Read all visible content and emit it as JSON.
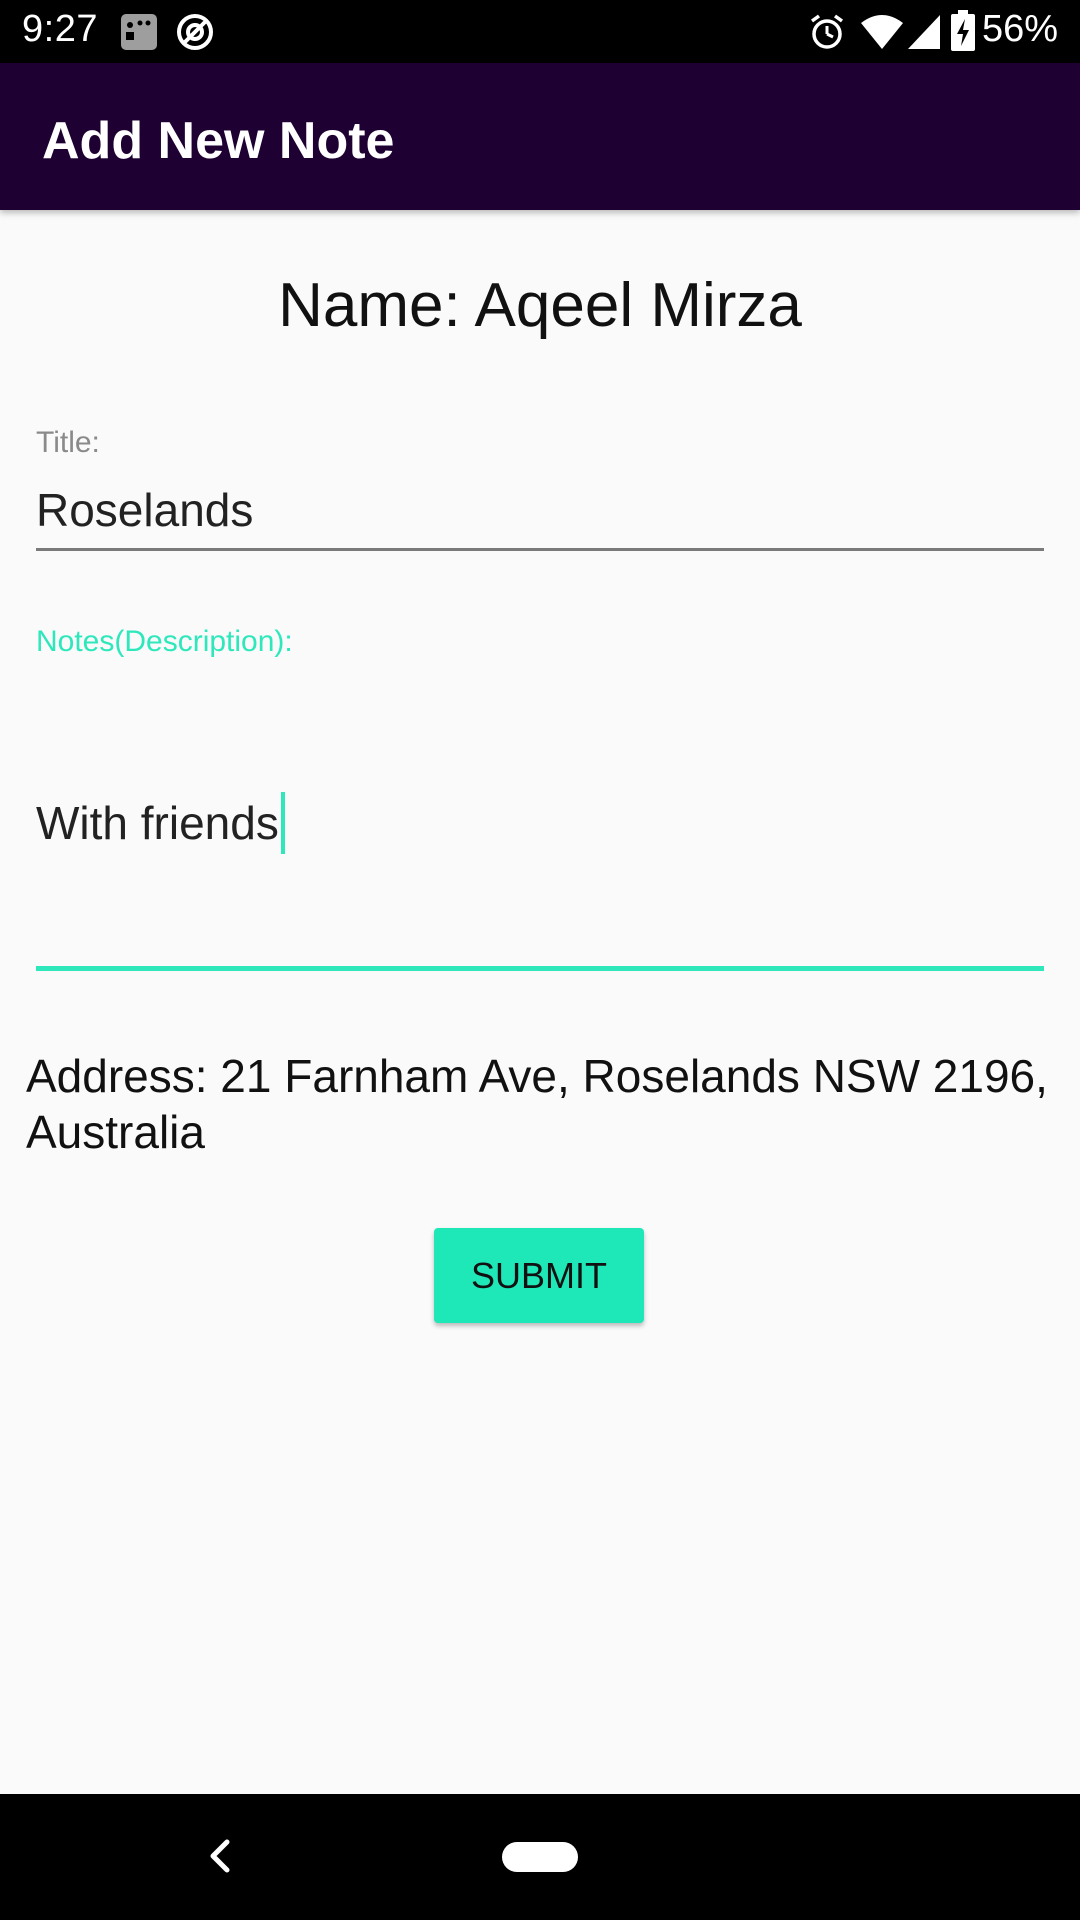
{
  "status_bar": {
    "time": "9:27",
    "battery": "56%",
    "icons": [
      "notification-icon",
      "no-disturb-icon",
      "alarm-icon",
      "wifi-icon",
      "signal-icon",
      "battery-icon"
    ]
  },
  "app_bar": {
    "title": "Add New Note",
    "color": "#1e0033"
  },
  "form": {
    "name_heading": "Name: Aqeel Mirza",
    "title_label": "Title:",
    "title_value": "Roselands",
    "notes_label": "Notes(Description):",
    "notes_value": "With friends",
    "address": "Address: 21 Farnham Ave, Roselands NSW 2196, Australia",
    "submit_label": "SUBMIT",
    "accent_color": "#2ee8bc"
  },
  "nav_bar": {
    "icons": [
      "back-icon",
      "home-icon"
    ]
  }
}
